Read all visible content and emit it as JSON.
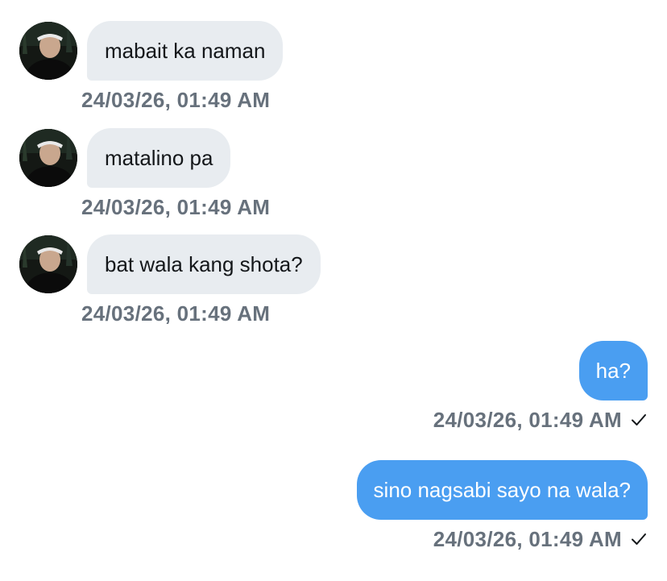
{
  "messages": [
    {
      "direction": "incoming",
      "text": "mabait ka naman",
      "time": "24/03/26, 01:49 AM",
      "avatar": "profile-photo"
    },
    {
      "direction": "incoming",
      "text": "matalino pa",
      "time": "24/03/26, 01:49 AM",
      "avatar": "profile-photo"
    },
    {
      "direction": "incoming",
      "text": "bat wala kang shota?",
      "time": "24/03/26, 01:49 AM",
      "avatar": "profile-photo"
    },
    {
      "direction": "outgoing",
      "text": "ha?",
      "time": "24/03/26, 01:49 AM",
      "status": "sent",
      "status_icon": "checkmark-icon"
    },
    {
      "direction": "outgoing",
      "text": "sino nagsabi sayo na wala?",
      "time": "24/03/26, 01:49 AM",
      "status": "sent",
      "status_icon": "checkmark-icon"
    }
  ],
  "colors": {
    "incoming_bubble": "#e8ecf0",
    "incoming_text": "#14171a",
    "outgoing_bubble": "#4a9ef1",
    "outgoing_text": "#ffffff",
    "timestamp": "#67717c",
    "background": "#ffffff"
  }
}
